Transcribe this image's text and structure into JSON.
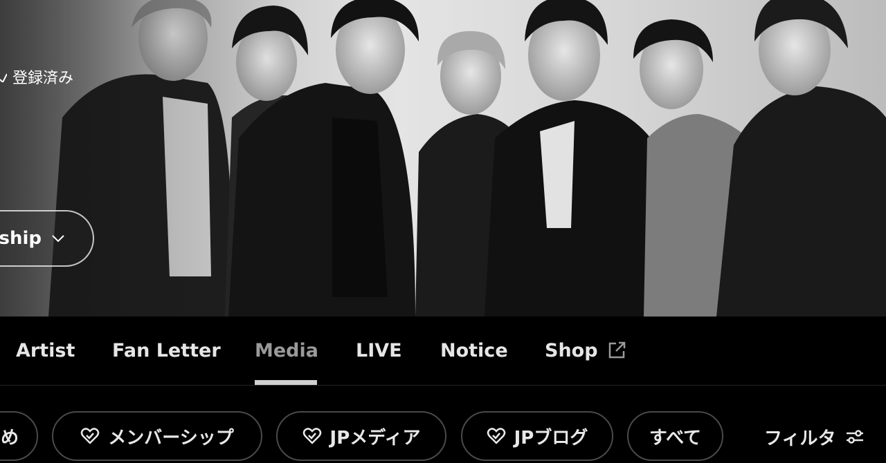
{
  "hero": {
    "registered_label": "登録済み",
    "membership_label": "ship"
  },
  "nav": {
    "tabs": [
      {
        "label": "Artist",
        "active": false
      },
      {
        "label": "Fan Letter",
        "active": false
      },
      {
        "label": "Media",
        "active": true
      },
      {
        "label": "LIVE",
        "active": false
      },
      {
        "label": "Notice",
        "active": false
      },
      {
        "label": "Shop",
        "active": false,
        "icon": "external-link-icon"
      }
    ]
  },
  "chips": [
    {
      "label": "め",
      "icon": ""
    },
    {
      "label": "メンバーシップ",
      "icon": "heart-check-icon"
    },
    {
      "label": "JPメディア",
      "icon": "heart-check-icon"
    },
    {
      "label": "JPブログ",
      "icon": "heart-check-icon"
    },
    {
      "label": "すべて",
      "icon": ""
    }
  ],
  "filter": {
    "label": "フィルタ",
    "icon": "sliders-icon"
  }
}
